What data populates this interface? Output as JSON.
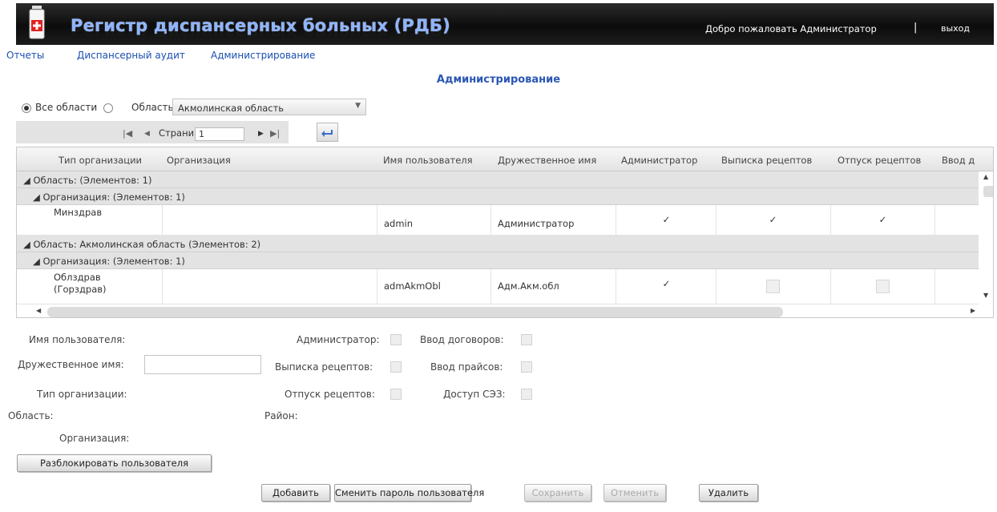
{
  "header": {
    "title": "Регистр диспансерных больных (РДБ)",
    "welcome": "Добро пожаловать Администратор",
    "separator": "|",
    "logout": "выход"
  },
  "menu": [
    "Отчеты",
    "Диспансерный аудит",
    "Администрирование"
  ],
  "page_title": "Администрирование",
  "region_filter": {
    "all_label": "Все области",
    "region_label": "Область",
    "selected_region": "Акмолинская область"
  },
  "pager": {
    "page_label": "Страница",
    "page_value": "1"
  },
  "grid": {
    "columns": [
      "Тип организации",
      "Организация",
      "Имя пользователя",
      "Дружественное имя",
      "Администратор",
      "Выписка рецептов",
      "Отпуск рецептов",
      "Ввод д"
    ],
    "groups": [
      "Область:  (Элементов: 1)",
      "Организация:  (Элементов: 1)",
      "Область: Акмолинская область (Элементов: 2)",
      "Организация:  (Элементов: 1)"
    ],
    "rows": [
      {
        "org_type": "Минздрав",
        "org": "",
        "username": "admin",
        "friendly": "Администратор",
        "admin": true,
        "rx_write": true,
        "rx_dispense": true
      },
      {
        "org_type": "Облздрав\n(Горздрав)",
        "org": "",
        "username": "admAkmObl",
        "friendly": "Адм.Акм.обл",
        "admin": true,
        "rx_write": false,
        "rx_dispense": false
      }
    ]
  },
  "form": {
    "username_label": "Имя пользователя:",
    "friendly_label": "Дружественное имя:",
    "orgtype_label": "Тип организации:",
    "region_label": "Область:",
    "org_label": "Организация:",
    "admin_label": "Администратор:",
    "rx_write_label": "Выписка рецептов:",
    "rx_dispense_label": "Отпуск рецептов:",
    "district_label": "Район:",
    "contracts_label": "Ввод договоров:",
    "prices_label": "Ввод прайсов:",
    "sez_label": "Доступ СЭЗ:"
  },
  "buttons": {
    "unlock": "Разблокировать пользователя",
    "add": "Добавить",
    "change_password": "Сменить пароль пользователя",
    "save": "Сохранить",
    "cancel": "Отменить",
    "delete": "Удалить"
  },
  "colors": {
    "header_bg": "#111111",
    "title": "#8fb4ff",
    "link": "#1a4fb0",
    "page_title": "#2a56b4"
  }
}
